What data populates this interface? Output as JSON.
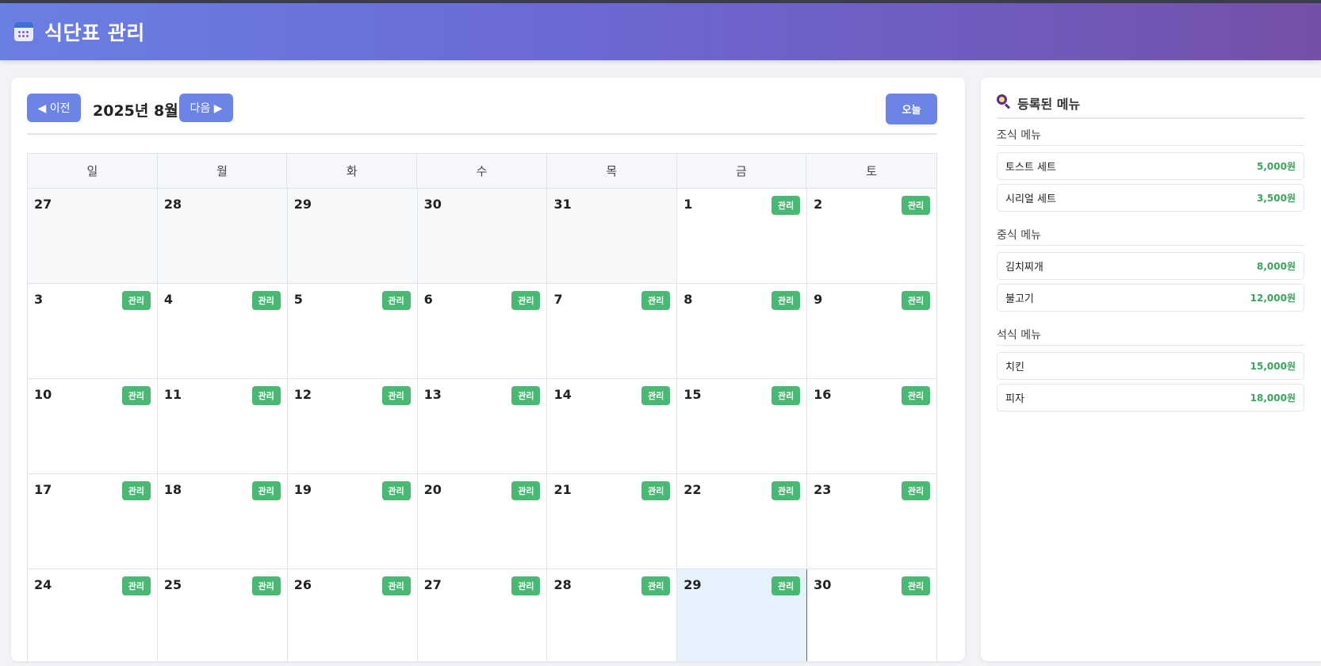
{
  "app": {
    "title": "식단표 관리",
    "icon": "calendar-icon"
  },
  "calendar": {
    "prev_label": "◀ 이전",
    "next_label": "다음 ▶",
    "month_label": "2025년 8월",
    "today_label": "오늘",
    "manage_label": "관리",
    "weekdays": [
      "일",
      "월",
      "화",
      "수",
      "목",
      "금",
      "토"
    ],
    "weeks": [
      [
        {
          "n": "27",
          "other": true
        },
        {
          "n": "28",
          "other": true
        },
        {
          "n": "29",
          "other": true
        },
        {
          "n": "30",
          "other": true
        },
        {
          "n": "31",
          "other": true
        },
        {
          "n": "1"
        },
        {
          "n": "2"
        }
      ],
      [
        {
          "n": "3"
        },
        {
          "n": "4"
        },
        {
          "n": "5"
        },
        {
          "n": "6"
        },
        {
          "n": "7"
        },
        {
          "n": "8"
        },
        {
          "n": "9"
        }
      ],
      [
        {
          "n": "10"
        },
        {
          "n": "11"
        },
        {
          "n": "12"
        },
        {
          "n": "13"
        },
        {
          "n": "14"
        },
        {
          "n": "15"
        },
        {
          "n": "16"
        }
      ],
      [
        {
          "n": "17"
        },
        {
          "n": "18"
        },
        {
          "n": "19"
        },
        {
          "n": "20"
        },
        {
          "n": "21"
        },
        {
          "n": "22"
        },
        {
          "n": "23"
        }
      ],
      [
        {
          "n": "24"
        },
        {
          "n": "25"
        },
        {
          "n": "26"
        },
        {
          "n": "27"
        },
        {
          "n": "28"
        },
        {
          "n": "29",
          "today": true
        },
        {
          "n": "30"
        }
      ]
    ]
  },
  "sidebar": {
    "title": "등록된 메뉴",
    "icon": "magnifier-icon",
    "sections": [
      {
        "title": "조식 메뉴",
        "items": [
          {
            "name": "토스트 세트",
            "price": "5,000원"
          },
          {
            "name": "시리얼 세트",
            "price": "3,500원"
          }
        ]
      },
      {
        "title": "중식 메뉴",
        "items": [
          {
            "name": "김치찌개",
            "price": "8,000원"
          },
          {
            "name": "불고기",
            "price": "12,000원"
          }
        ]
      },
      {
        "title": "석식 메뉴",
        "items": [
          {
            "name": "치킨",
            "price": "15,000원"
          },
          {
            "name": "피자",
            "price": "18,000원"
          }
        ]
      }
    ]
  },
  "colors": {
    "header_start": "#6a7fe3",
    "header_end": "#7450a9",
    "nav_button": "#6c84e6",
    "manage_button": "#48b873",
    "price": "#3aa55e",
    "today_cell": "#e6f1fe"
  }
}
